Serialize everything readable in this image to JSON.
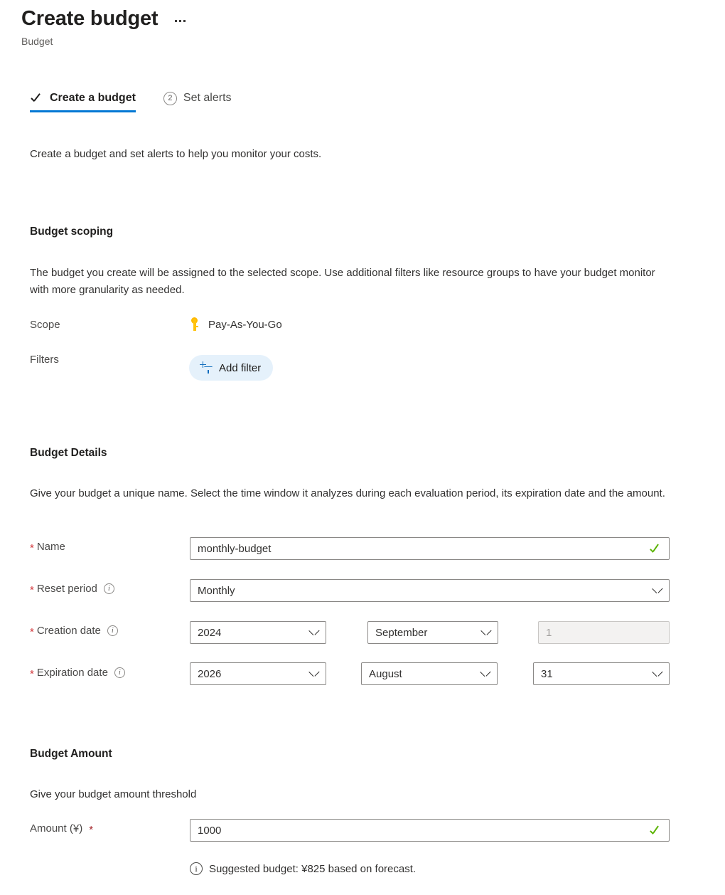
{
  "header": {
    "title": "Create budget",
    "subtitle": "Budget",
    "more_menu": "…"
  },
  "tabs": [
    {
      "label": "Create a budget",
      "state": "completed",
      "marker": "check"
    },
    {
      "label": "Set alerts",
      "state": "pending",
      "marker": "2"
    }
  ],
  "intro": "Create a budget and set alerts to help you monitor your costs.",
  "budget_scoping": {
    "heading": "Budget scoping",
    "description": "The budget you create will be assigned to the selected scope. Use additional filters like resource groups to have your budget monitor with more granularity as needed.",
    "scope_label": "Scope",
    "scope_value": "Pay-As-You-Go",
    "filters_label": "Filters",
    "add_filter_label": "Add filter"
  },
  "budget_details": {
    "heading": "Budget Details",
    "description": "Give your budget a unique name. Select the time window it analyzes during each evaluation period, its expiration date and the amount.",
    "name_label": "Name",
    "name_value": "monthly-budget",
    "reset_period_label": "Reset period",
    "reset_period_value": "Monthly",
    "creation_date_label": "Creation date",
    "creation_year": "2024",
    "creation_month": "September",
    "creation_day": "1",
    "expiration_date_label": "Expiration date",
    "expiration_year": "2026",
    "expiration_month": "August",
    "expiration_day": "31"
  },
  "budget_amount": {
    "heading": "Budget Amount",
    "description": "Give your budget amount threshold",
    "amount_label": "Amount (¥)",
    "amount_value": "1000",
    "suggested_text": "Suggested budget: ¥825 based on forecast."
  },
  "colors": {
    "accent": "#0078d4",
    "required": "#d13438",
    "valid": "#5ab300",
    "pill_bg": "#e5f1fb"
  }
}
